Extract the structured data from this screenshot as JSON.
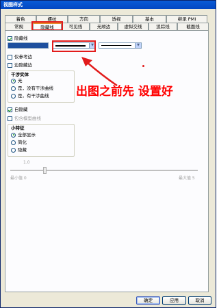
{
  "window": {
    "title": "视图样式"
  },
  "tabs_top": [
    "着色",
    "螺纹",
    "方向",
    "透视",
    "基本",
    "继承 PMI"
  ],
  "tabs_bottom": [
    "常规",
    "隐藏线",
    "可见线",
    "光顺边",
    "虚拟交线",
    "追踪线",
    "截面线"
  ],
  "active_tab": "隐藏线",
  "hidden_lines": {
    "label": "隐藏线",
    "checked": true
  },
  "line_style_options": {
    "color_swatch": "#1d4f9e"
  },
  "options": [
    {
      "label": "仅参考边",
      "checked": false
    },
    {
      "label": "边隐藏边",
      "checked": false
    }
  ],
  "interference": {
    "title": "干涉实体",
    "options": [
      "无",
      "是，没有干涉曲线",
      "是，有干涉曲线"
    ],
    "selected": 0
  },
  "self_hidden": {
    "label": "自隐藏",
    "checked": true
  },
  "include_model_curves": {
    "label": "包含模型曲线",
    "checked": false
  },
  "small_features": {
    "title": "小特征",
    "options": [
      "全部显示",
      "简化",
      "隐藏"
    ],
    "selected": 0
  },
  "slider": {
    "value": "1.0",
    "min_label": "最小值 0",
    "max_label": "最大值 5",
    "position_fraction": 0.2
  },
  "buttons": {
    "ok": "确定",
    "apply": "应用",
    "cancel": "取消"
  },
  "annotation": {
    "text": "出图之前先 设置好"
  },
  "colors": {
    "annotation": "#ff0000",
    "titlebar": "#0347c2"
  }
}
